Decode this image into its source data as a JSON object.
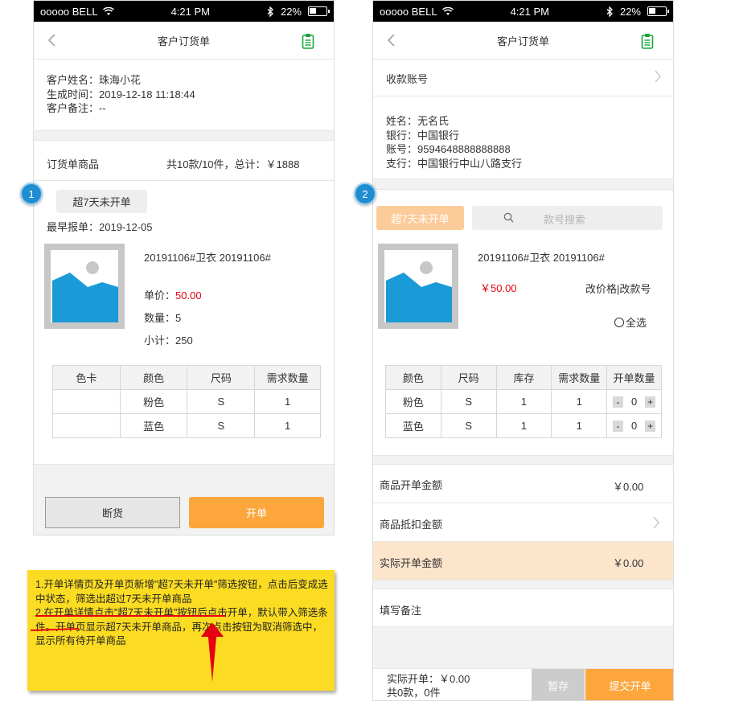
{
  "status": {
    "carrier": "ooooo BELL",
    "time": "4:21 PM",
    "battery": "22%"
  },
  "screen1": {
    "title": "客户订货单",
    "customer_name": "客户姓名：珠海小花",
    "created_time": "生成时间：2019-12-18 11:18:44",
    "customer_note": "客户备注：--",
    "goods_label": "订货单商品",
    "goods_summary": "共10款/10件，总计：￥1888",
    "step_badge": "1",
    "filter_button": "超7天未开单",
    "earliest_date": "最早报单：2019-12-05",
    "product_name": "20191106#卫衣 20191106#",
    "unit_price_label": "单价：",
    "unit_price": "50.00",
    "quantity": "数量：5",
    "subtotal": "小计：250",
    "table": {
      "headers": [
        "色卡",
        "颜色",
        "尺码",
        "需求数量"
      ],
      "rows": [
        [
          "",
          "粉色",
          "S",
          "1"
        ],
        [
          "",
          "蓝色",
          "S",
          "1"
        ]
      ]
    },
    "stockout_button": "断货",
    "open_button": "开单"
  },
  "screen2": {
    "title": "客户订货单",
    "payment_account": "收款账号",
    "name": "姓名：无名氏",
    "bank": "银行：中国银行",
    "account_no": "账号：9594648888888888",
    "branch": "支行：中国银行中山八路支行",
    "step_badge": "2",
    "filter_button": "超7天未开单",
    "search_placeholder": "款号搜索",
    "product_name": "20191106#卫衣 20191106#",
    "price": "￥50.00",
    "edit_price": "改价格|改款号",
    "select_all": "全选",
    "table": {
      "headers": [
        "颜色",
        "尺码",
        "库存",
        "需求数量",
        "开单数量"
      ],
      "rows": [
        [
          "粉色",
          "S",
          "1",
          "1",
          "0"
        ],
        [
          "蓝色",
          "S",
          "1",
          "1",
          "0"
        ]
      ]
    },
    "minus": "-",
    "plus": "+",
    "goods_amount_label": "商品开单金额",
    "goods_amount": "￥0.00",
    "deduct_label": "商品抵扣金额",
    "actual_amount_label": "实际开单金额",
    "actual_amount": "￥0.00",
    "remark_label": "填写备注",
    "bottom_actual": "实际开单：￥0.00",
    "bottom_count": "共0款，0件",
    "save_button": "暂存",
    "submit_button": "提交开单"
  },
  "note": {
    "line1": "1.开单详情页及开单页新增\"超7天未开单\"筛选按钮，点击后变成选中状态，筛选出超过7天未开单商品",
    "line2": "2.在开单详情点击\"超7天未开单\"按钮后点击开单，默认带入筛选条件。开单页显示超7天未开单商品，再次点击按钮为取消筛选中，显示所有待开单商品"
  },
  "colors": {
    "accent": "#fca63c",
    "accent_light": "#fccb9a",
    "price_red": "#e60012",
    "highlight_row": "#fde5cc",
    "note_bg": "#fbdc22",
    "badge_blue": "#1e8ed0"
  }
}
